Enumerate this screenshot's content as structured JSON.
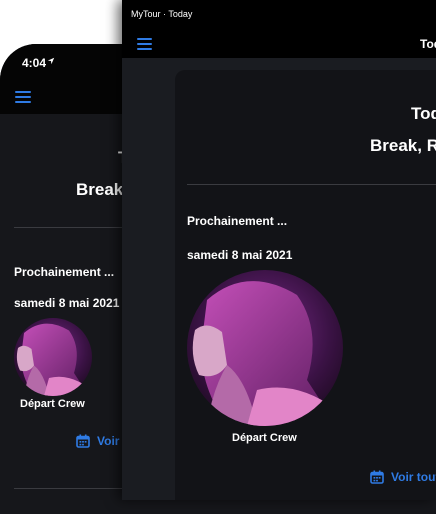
{
  "phone": {
    "status_time": "4:04",
    "title_line1": "T",
    "title_line2": "Break",
    "upcoming_label": "Prochainement ...",
    "date": "samedi 8 mai 2021",
    "event_caption": "Départ Crew",
    "see_all": "Voir"
  },
  "window": {
    "title": "MyTour · Today",
    "appbar_title": "Tod",
    "card_title_line1": "Tod",
    "card_title_line2": "Break, R",
    "upcoming_label": "Prochainement ...",
    "date": "samedi 8 mai 2021",
    "event_caption": "Départ Crew",
    "see_all": "Voir tout"
  },
  "colors": {
    "accent": "#2f7be4",
    "background": "#16171b",
    "card": "#121317",
    "bar": "#000000"
  },
  "icons": {
    "menu": "hamburger-icon",
    "calendar": "calendar-icon",
    "location": "location-arrow-icon"
  }
}
